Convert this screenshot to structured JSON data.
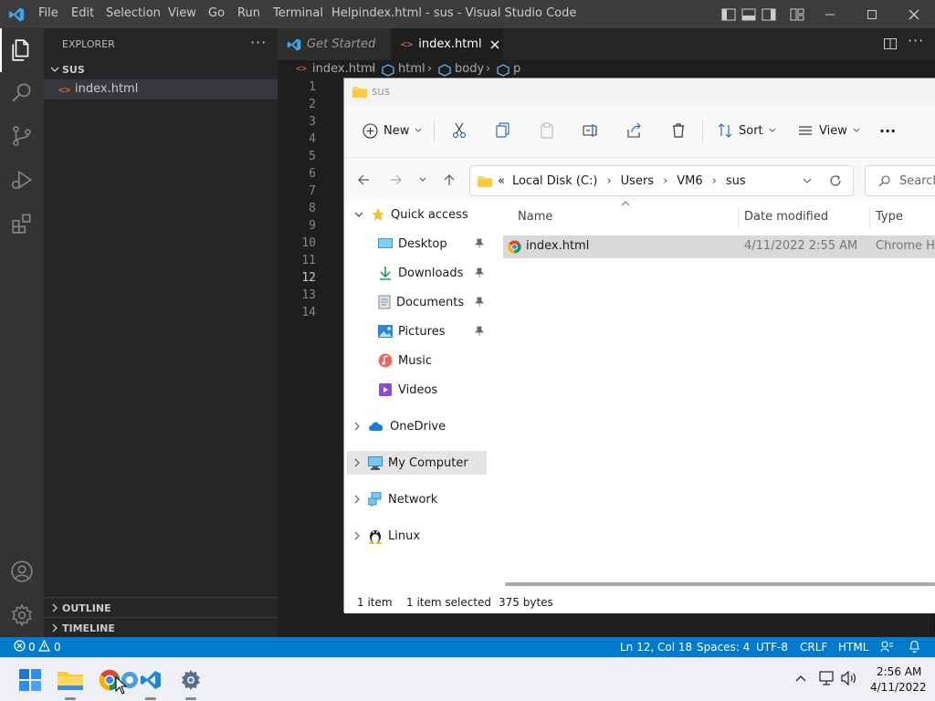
{
  "vscode": {
    "menu": [
      "File",
      "Edit",
      "Selection",
      "View",
      "Go",
      "Run",
      "Terminal",
      "Help"
    ],
    "window_title": "index.html - sus - Visual Studio Code",
    "sidebar": {
      "title": "EXPLORER",
      "folder": "SUS",
      "file": "index.html",
      "outline": "OUTLINE",
      "timeline": "TIMELINE"
    },
    "tabs": [
      {
        "label": "Get Started"
      },
      {
        "label": "index.html"
      }
    ],
    "breadcrumb": [
      "index.html",
      "html",
      "body",
      "p"
    ],
    "line_numbers": [
      "1",
      "2",
      "3",
      "4",
      "5",
      "6",
      "7",
      "8",
      "9",
      "10",
      "11",
      "12",
      "13",
      "14"
    ],
    "statusbar": {
      "errors": "0",
      "warnings": "0",
      "position": "Ln 12, Col 18",
      "spaces": "Spaces: 4",
      "encoding": "UTF-8",
      "eol": "CRLF",
      "language": "HTML"
    }
  },
  "explorer": {
    "title": "sus",
    "toolbar": {
      "new": "New",
      "sort": "Sort",
      "view": "View",
      "more": "···"
    },
    "address": {
      "prefix": "«",
      "segments": [
        "Local Disk (C:)",
        "Users",
        "VM6",
        "sus"
      ]
    },
    "search_placeholder": "Search",
    "nav": {
      "quick_access": "Quick access",
      "pinned": [
        "Desktop",
        "Downloads",
        "Documents",
        "Pictures"
      ],
      "unpinned": [
        "Music",
        "Videos"
      ],
      "onedrive": "OneDrive",
      "my_computer": "My Computer",
      "network": "Network",
      "linux": "Linux"
    },
    "columns": {
      "name": "Name",
      "date": "Date modified",
      "type": "Type"
    },
    "files": [
      {
        "name": "index.html",
        "date": "4/11/2022 2:55 AM",
        "type": "Chrome HTM"
      }
    ],
    "status": {
      "count": "1 item",
      "selected": "1 item selected",
      "size": "375 bytes"
    }
  },
  "taskbar": {
    "time": "2:56 AM",
    "date": "4/11/2022"
  },
  "colors": {
    "vscode_blue": "#007acc",
    "selection": "#cce8ff"
  }
}
